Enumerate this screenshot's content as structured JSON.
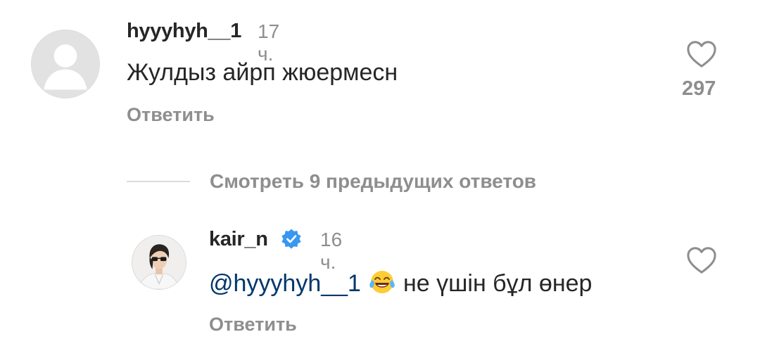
{
  "comment1": {
    "username": "hyyyhyh__1",
    "time": "17 ч.",
    "text": "Жулдыз айрп жюермесн",
    "reply_label": "Ответить",
    "like_count": "297",
    "avatar_icon": "default-avatar-icon",
    "like_icon": "heart-outline-icon"
  },
  "view_replies": {
    "label": "Смотреть 9 предыдущих ответов"
  },
  "comment2": {
    "username": "kair_n",
    "verified_icon": "verified-badge-icon",
    "time": "16 ч.",
    "mention": "@hyyyhyh__1",
    "emoji": "face-with-tears-of-joy",
    "text": "не үшін бұл өнер",
    "reply_label": "Ответить",
    "like_icon": "heart-outline-icon"
  },
  "colors": {
    "text": "#262626",
    "secondary": "#8e8e8e",
    "mention": "#00376b",
    "verified": "#3897f0",
    "divider": "#dbdbdb"
  }
}
